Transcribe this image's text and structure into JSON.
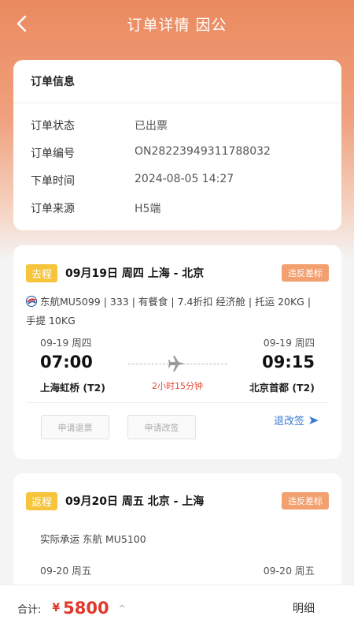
{
  "header": {
    "title": "订单详情 因公"
  },
  "order_info": {
    "title": "订单信息",
    "rows": [
      {
        "label": "订单状态",
        "value": "已出票"
      },
      {
        "label": "订单编号",
        "value": "ON28223949311788032"
      },
      {
        "label": "下单时间",
        "value": "2024-08-05 14:27"
      },
      {
        "label": "订单来源",
        "value": "H5端"
      }
    ]
  },
  "trip_out": {
    "tag": "去程",
    "title": "09月19日 周四 上海 - 北京",
    "violation": "违反差标",
    "flight_info_1": "东航MU5099 | 333 | 有餐食 | 7.4折扣 经济舱 | 托运 20KG |",
    "flight_info_2": "手提 10KG",
    "dep_date": "09-19 周四",
    "arr_date": "09-19 周四",
    "dep_time": "07:00",
    "arr_time": "09:15",
    "dep_airport": "上海虹桥 (T2)",
    "arr_airport": "北京首都 (T2)",
    "duration": "2小时15分钟",
    "refund_btn": "申请退票",
    "change_btn": "申请改签",
    "rules_link": "退改签"
  },
  "trip_return": {
    "tag": "返程",
    "title": "09月20日 周五 北京 - 上海",
    "violation": "违反差标",
    "carrier": "实际承运 东航 MU5100",
    "dep_date": "09-20 周五",
    "arr_date": "09-20 周五"
  },
  "bottom": {
    "total_label": "合计:",
    "currency": "¥",
    "amount": "5800",
    "caret": "^",
    "detail": "明细"
  },
  "colors": {
    "accent_orange": "#ea8a5f",
    "tag_yellow": "#f7c53b",
    "price_red": "#e2372b",
    "link_blue": "#3a7ad3"
  }
}
